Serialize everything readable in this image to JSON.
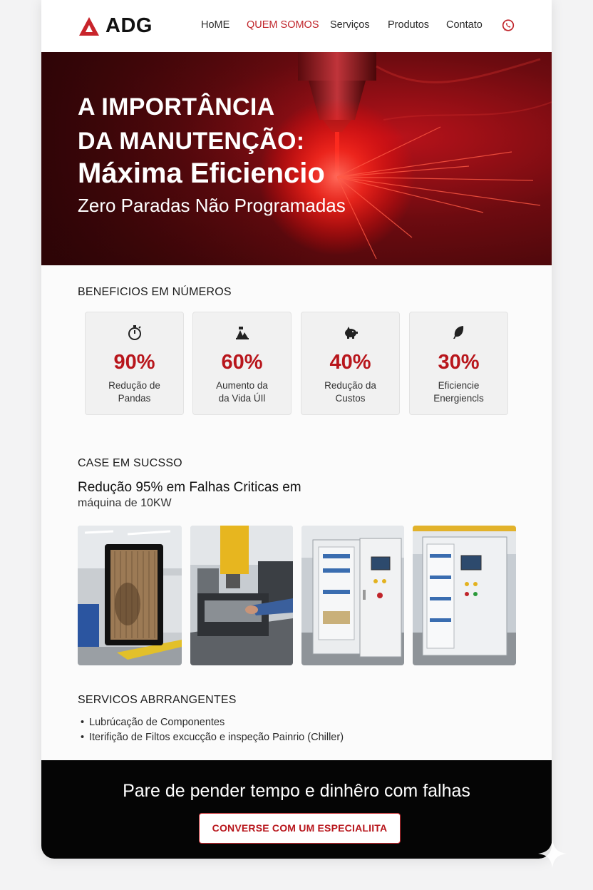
{
  "header": {
    "logo_text": "ADG",
    "nav": [
      {
        "label": "HoME",
        "active": false
      },
      {
        "label": "QUEM SOMOS",
        "active": true
      },
      {
        "label": "Serviços",
        "active": false
      },
      {
        "label": "Produtos",
        "active": false
      },
      {
        "label": "Contato",
        "active": false
      }
    ],
    "whatsapp_icon": "whatsapp-icon"
  },
  "hero": {
    "title_line1": "A IMPORTÂNCIA",
    "title_line2": "DA MANUTENÇÃO:",
    "title_line3": "Máxima Eficiencio",
    "subtitle": "Zero Paradas Não Programadas"
  },
  "benefits": {
    "title": "BENEFICIOS EM NÚMEROS",
    "items": [
      {
        "icon": "stopwatch-icon",
        "value": "90%",
        "label_line1": "Redução de",
        "label_line2": "Pandas"
      },
      {
        "icon": "machinery-icon",
        "value": "60%",
        "label_line1": "Aumento da",
        "label_line2": "da Vida ÚIl"
      },
      {
        "icon": "piggy-bank-icon",
        "value": "40%",
        "label_line1": "Redução da",
        "label_line2": "Custos"
      },
      {
        "icon": "leaf-icon",
        "value": "30%",
        "label_line1": "Eficiencie",
        "label_line2": "Energiencls"
      }
    ]
  },
  "case": {
    "title": "CASE EM SUCSSO",
    "headline": "Redução 95% em Falhas Criticas em",
    "subline": "máquina de 10KW",
    "photos": [
      "dirty-filter-photo",
      "laser-machine-photo",
      "electrical-panel-open-photo",
      "electrical-panel-photo"
    ]
  },
  "services": {
    "title": "SERVICOS ABRRANGENTES",
    "items": [
      "Lubrúcação de Componentes",
      "Iterifição de Filtos excucção e inspeção Painrio (Chiller)"
    ]
  },
  "cta": {
    "title": "Pare de pender tempo e dinhêro com falhas",
    "button_label": "CONVERSE COM UM ESPECIALIITA"
  },
  "colors": {
    "accent": "#c0242a",
    "hero_dark": "#3a0608",
    "cta_bg": "#050505"
  }
}
